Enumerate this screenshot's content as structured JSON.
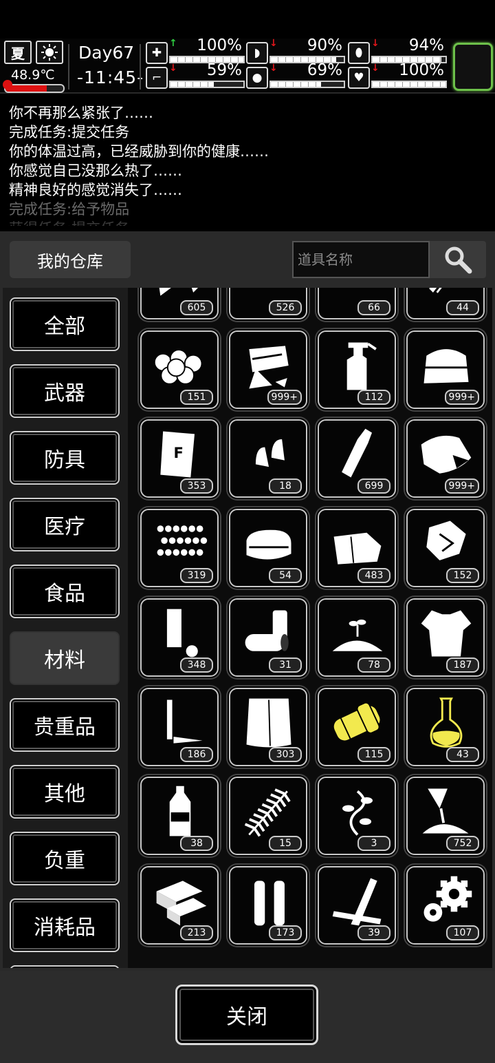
{
  "status": {
    "season": "夏",
    "weather_icon": "sun-icon",
    "temperature": "48.9℃",
    "temperature_level": 0.72,
    "day": "Day67",
    "time": "-11:45-",
    "stats": [
      {
        "icon": "medkit-icon",
        "trend": "up",
        "value": "100%",
        "level": 1.0
      },
      {
        "icon": "stomach-icon",
        "trend": "down",
        "value": "90%",
        "level": 0.9
      },
      {
        "icon": "pill-icon",
        "trend": "down",
        "value": "94%",
        "level": 0.94
      },
      {
        "icon": "boot-icon",
        "trend": "down",
        "value": "59%",
        "level": 0.59
      },
      {
        "icon": "water-drop-icon",
        "trend": "down",
        "value": "69%",
        "level": 0.69
      },
      {
        "icon": "heart-icon",
        "trend": "down",
        "value": "100%",
        "level": 1.0
      }
    ],
    "colors": {
      "up": "#2ecc40",
      "down": "#e0161b",
      "equip_border": "#6dc04a"
    }
  },
  "log": [
    "你不再那么紧张了……",
    "完成任务:提交任务",
    "你的体温过高，已经威胁到你的健康……",
    "你感觉自己没那么热了……",
    "精神良好的感觉消失了……",
    "完成任务:给予物品",
    "获得任务:提交任务"
  ],
  "panel": {
    "title": "我的仓库",
    "search_placeholder": "道具名称",
    "close_label": "关闭"
  },
  "categories": [
    {
      "label": "全部",
      "selected": false
    },
    {
      "label": "武器",
      "selected": false
    },
    {
      "label": "防具",
      "selected": false
    },
    {
      "label": "医疗",
      "selected": false
    },
    {
      "label": "食品",
      "selected": false
    },
    {
      "label": "材料",
      "selected": true
    },
    {
      "label": "贵重品",
      "selected": false
    },
    {
      "label": "其他",
      "selected": false
    },
    {
      "label": "负重",
      "selected": false
    },
    {
      "label": "消耗品",
      "selected": false
    }
  ],
  "items": [
    {
      "icon": "cloth-scraps-icon",
      "qty": "605"
    },
    {
      "icon": "logs-icon",
      "qty": "526"
    },
    {
      "icon": "fur-icon",
      "qty": "66"
    },
    {
      "icon": "blade-icon",
      "qty": "44"
    },
    {
      "icon": "cotton-balls-icon",
      "qty": "151"
    },
    {
      "icon": "paper-scraps-icon",
      "qty": "999+"
    },
    {
      "icon": "spray-bottle-icon",
      "qty": "112"
    },
    {
      "icon": "folded-cloth-icon",
      "qty": "999+"
    },
    {
      "icon": "fertilizer-bag-icon",
      "qty": "353"
    },
    {
      "icon": "bullet-tips-icon",
      "qty": "18"
    },
    {
      "icon": "glass-bottle-icon",
      "qty": "699"
    },
    {
      "icon": "leather-hide-icon",
      "qty": "999+"
    },
    {
      "icon": "beads-icon",
      "qty": "319"
    },
    {
      "icon": "towel-icon",
      "qty": "54"
    },
    {
      "icon": "cloth-sheet-icon",
      "qty": "483"
    },
    {
      "icon": "crumpled-paper-icon",
      "qty": "152"
    },
    {
      "icon": "tube-cap-icon",
      "qty": "348"
    },
    {
      "icon": "tin-cans-icon",
      "qty": "31"
    },
    {
      "icon": "soil-sprout-icon",
      "qty": "78"
    },
    {
      "icon": "torn-shirt-icon",
      "qty": "187"
    },
    {
      "icon": "nail-pin-icon",
      "qty": "186"
    },
    {
      "icon": "paper-stack-icon",
      "qty": "303"
    },
    {
      "icon": "yellow-capsule-icon",
      "qty": "115",
      "color": "#f2e94e"
    },
    {
      "icon": "flask-icon",
      "qty": "43",
      "color": "#f2e94e"
    },
    {
      "icon": "plastic-bottle-icon",
      "qty": "38"
    },
    {
      "icon": "fern-leaf-icon",
      "qty": "15"
    },
    {
      "icon": "vine-icon",
      "qty": "3"
    },
    {
      "icon": "powder-icon",
      "qty": "752"
    },
    {
      "icon": "bricks-icon",
      "qty": "213"
    },
    {
      "icon": "cartridges-icon",
      "qty": "173"
    },
    {
      "icon": "planks-icon",
      "qty": "39"
    },
    {
      "icon": "gears-icon",
      "qty": "107"
    }
  ]
}
